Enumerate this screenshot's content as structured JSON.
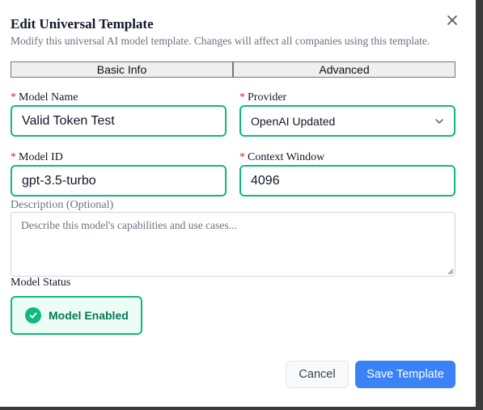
{
  "dialog": {
    "title": "Edit Universal Template",
    "subtitle": "Modify this universal AI model template. Changes will affect all companies using this template.",
    "close_icon": "close-icon"
  },
  "tabs": [
    {
      "label": "Basic Info"
    },
    {
      "label": "Advanced"
    }
  ],
  "form": {
    "required_marker": "*",
    "model_name": {
      "label": "Model Name",
      "value": "Valid Token Test"
    },
    "provider": {
      "label": "Provider",
      "value": "OpenAI Updated"
    },
    "model_id": {
      "label": "Model ID",
      "value": "gpt-3.5-turbo"
    },
    "context_window": {
      "label": "Context Window",
      "value": "4096"
    },
    "description": {
      "label": "Description (Optional)",
      "value": "",
      "placeholder": "Describe this model's capabilities and use cases..."
    },
    "status": {
      "label": "Model Status",
      "button_label": "Model Enabled",
      "icon": "check-circle-icon"
    }
  },
  "footer": {
    "cancel_label": "Cancel",
    "save_label": "Save Template"
  },
  "colors": {
    "accent": "#10b981",
    "primary_button": "#3b82f6",
    "required": "#dc2626"
  }
}
